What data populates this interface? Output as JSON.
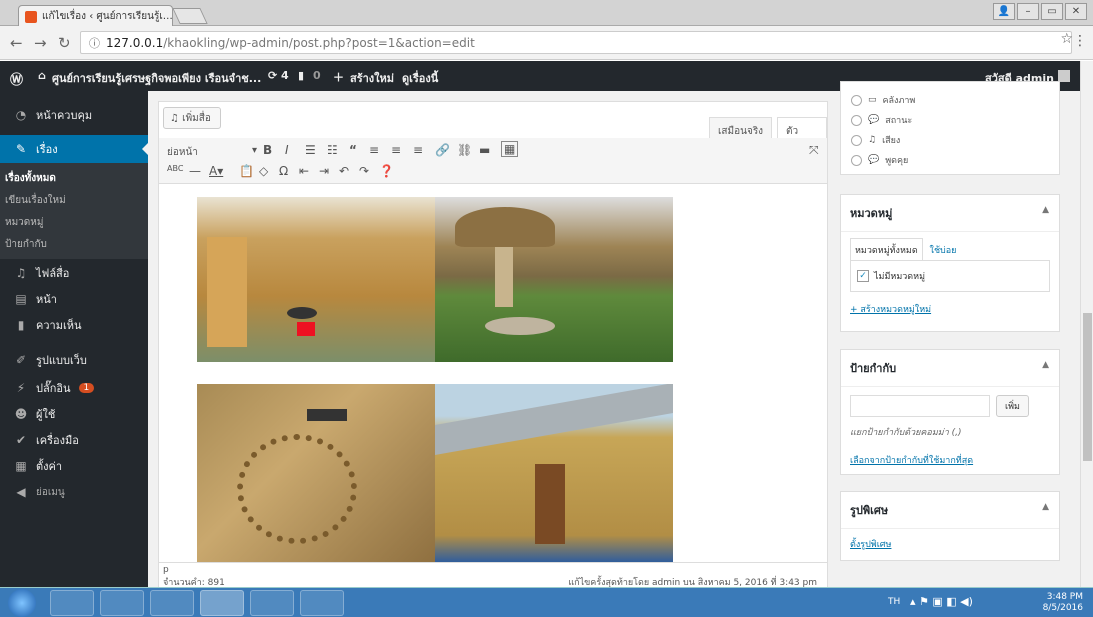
{
  "browser": {
    "tab_title": "แก้ไขเรื่อง ‹ ศูนย์การเรียนรู้เ…",
    "url_host": "127.0.0.1",
    "url_path": "/khaokling/wp-admin/post.php?post=1&action=edit"
  },
  "adminbar": {
    "site": "ศูนย์การเรียนรู้เศรษฐกิจพอเพียง เรือนจำช...",
    "updates": "4",
    "comments": "0",
    "new": "สร้างใหม่",
    "view": "ดูเรื่องนี้",
    "howdy": "สวัสดี admin"
  },
  "sidebar": {
    "dashboard": "หน้าควบคุม",
    "posts": "เรื่อง",
    "sub": [
      "เรื่องทั้งหมด",
      "เขียนเรื่องใหม่",
      "หมวดหมู่",
      "ป้ายกำกับ"
    ],
    "media": "ไฟล์สื่อ",
    "pages": "หน้า",
    "comments": "ความเห็น",
    "appearance": "รูปแบบเว็บ",
    "plugins": "ปลั๊กอิน",
    "plugin_badge": "1",
    "users": "ผู้ใช้",
    "tools": "เครื่องมือ",
    "settings": "ตั้งค่า",
    "collapse": "ย่อเมนู"
  },
  "editor": {
    "add_media": "เพิ่มสื่อ",
    "visual_tab": "เสมือนจริง",
    "text_tab": "ตัวอักษร",
    "format": "ย่อหน้า",
    "path": "p",
    "word_count": "จำนวนคำ: 891",
    "last_edit": "แก้ไขครั้งสุดท้ายโดย admin บน สิงหาคม 5, 2016 ที่ 3:43 pm"
  },
  "format_box": {
    "items": [
      "คลังภาพ",
      "สถานะ",
      "เสียง",
      "พูดคุย"
    ]
  },
  "categories": {
    "title": "หมวดหมู่",
    "tab_all": "หมวดหมู่ทั้งหมด",
    "tab_popular": "ใช้บ่อย",
    "item": "ไม่มีหมวดหมู่",
    "add": "+ สร้างหมวดหมู่ใหม่"
  },
  "tags": {
    "title": "ป้ายกำกับ",
    "add_btn": "เพิ่ม",
    "hint": "แยกป้ายกำกับด้วยคอมม่า (,)",
    "choose": "เลือกจากป้ายกำกับที่ใช้มากที่สุด"
  },
  "featured": {
    "title": "รูปพิเศษ",
    "set": "ตั้งรูปพิเศษ"
  },
  "taskbar": {
    "lang": "TH",
    "time": "3:48 PM",
    "date": "8/5/2016"
  }
}
